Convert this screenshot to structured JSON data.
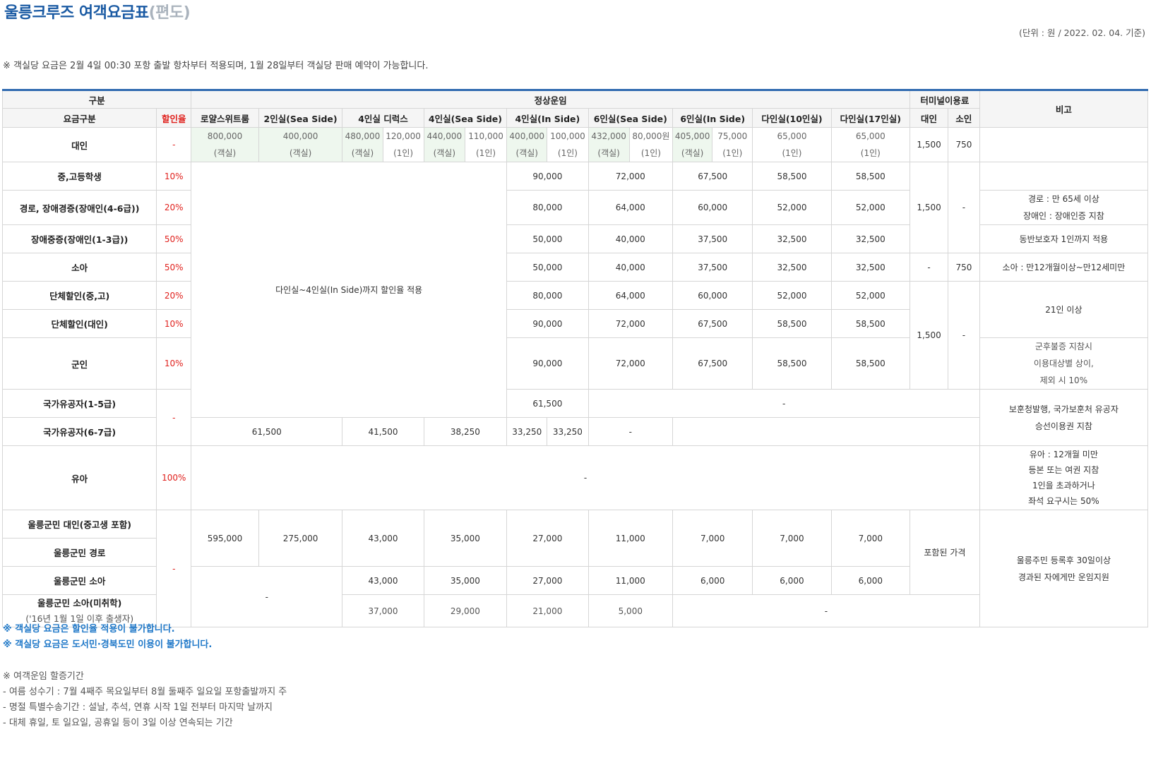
{
  "header": {
    "title": "울릉크루즈 여객요금표",
    "title_suffix": "(편도)",
    "unit_note": "(단위 : 원 / 2022. 02. 04. 기준)",
    "top_note": "※ 객실당 요금은 2월 4일 00:30 포항 출발 항차부터 적용되며, 1월 28일부터 객실당 판매 예약이 가능합니다."
  },
  "table": {
    "h_gubun": "구분",
    "h_normal": "정상운임",
    "h_terminal": "터미널이용료",
    "h_note": "비고",
    "h_fare_type": "요금구분",
    "h_discount": "할인율",
    "h_rooms": [
      "로얄스위트룸",
      "2인실(Sea Side)",
      "4인실 디럭스",
      "4인실(Sea Side)",
      "4인실(In Side)",
      "6인실(Sea Side)",
      "6인실(In Side)",
      "다인실(10인실)",
      "다인실(17인실)"
    ],
    "h_adult": "대인",
    "h_child": "소인",
    "adult": {
      "label": "대인",
      "rate": "-",
      "royal": "800,000",
      "two": "400,000",
      "dlx_room": "480,000",
      "dlx_person": "120,000",
      "sea4_room": "440,000",
      "sea4_person": "110,000",
      "in4_room": "400,000",
      "in4_person": "100,000",
      "sea6_room": "432,000",
      "sea6_person": "80,000원",
      "in6_room": "405,000",
      "in6_person": "75,000",
      "m10": "65,000",
      "m17": "65,000",
      "per_room": "(객실)",
      "per_person": "(1인)",
      "t_adult": "1,500",
      "t_child": "750"
    },
    "discount_note": "다인실~4인실(In Side)까지 할인율 적용",
    "rows": [
      {
        "label": "중,고등학생",
        "rate": "10%",
        "in4": "90,000",
        "sea6": "72,000",
        "in6": "67,500",
        "m10": "58,500",
        "m17": "58,500"
      },
      {
        "label": "경로, 장애경증(장애인(4-6급))",
        "rate": "20%",
        "in4": "80,000",
        "sea6": "64,000",
        "in6": "60,000",
        "m10": "52,000",
        "m17": "52,000"
      },
      {
        "label": "장애중증(장애인(1-3급))",
        "rate": "50%",
        "in4": "50,000",
        "sea6": "40,000",
        "in6": "37,500",
        "m10": "32,500",
        "m17": "32,500"
      },
      {
        "label": "소아",
        "rate": "50%",
        "in4": "50,000",
        "sea6": "40,000",
        "in6": "37,500",
        "m10": "32,500",
        "m17": "32,500"
      },
      {
        "label": "단체할인(중,고)",
        "rate": "20%",
        "in4": "80,000",
        "sea6": "64,000",
        "in6": "60,000",
        "m10": "52,000",
        "m17": "52,000"
      },
      {
        "label": "단체할인(대인)",
        "rate": "10%",
        "in4": "90,000",
        "sea6": "72,000",
        "in6": "67,500",
        "m10": "58,500",
        "m17": "58,500"
      },
      {
        "label": "군인",
        "rate": "10%",
        "in4": "90,000",
        "sea6": "72,000",
        "in6": "67,500",
        "m10": "58,500",
        "m17": "58,500"
      }
    ],
    "term_1500": "1,500",
    "term_dash": "-",
    "term_750": "750",
    "notes": {
      "elderly_1": "경로 : 만 65세 이상",
      "elderly_2": "장애인 : 장애인증 지참",
      "severe": "동반보호자 1인까지 적용",
      "child": "소아 : 만12개월이상~만12세미만",
      "group": "21인 이상",
      "soldier_1": "군후불증 지참시",
      "soldier_2": "이용대상별 상이,",
      "soldier_3": "제외 시 10%",
      "veteran_1": "보훈청발행, 국가보훈처 유공자",
      "veteran_2": "승선이용권 지참",
      "infant_1": "유아 : 12개월 미만",
      "infant_2": "등본 또는 여권 지참",
      "infant_3": "1인을 초과하거나",
      "infant_4": "좌석 요구시는 50%",
      "ulleung_1": "울릉주민 등록후 30일이상",
      "ulleung_2": "경과된 자에게만 운임지원"
    },
    "veteran1": {
      "label": "국가유공자(1-5급)",
      "in4": "61,500",
      "rest": "-"
    },
    "veteran2": {
      "label": "국가유공자(6-7급)",
      "in4": "61,500",
      "sea6": "41,500",
      "in6": "38,250",
      "m10": "33,250",
      "m17": "33,250",
      "term": "-"
    },
    "veteran_rate": "-",
    "infant": {
      "label": "유아",
      "rate": "100%",
      "value": "-"
    },
    "ulleung_rate": "-",
    "ulleung_adult": {
      "label": "울릉군민 대인(중고생 포함)",
      "royal": "595,000",
      "two": "275,000",
      "dlx": "43,000",
      "sea4": "35,000",
      "in4": "27,000",
      "sea6": "11,000",
      "in6": "7,000",
      "m10": "7,000",
      "m17": "7,000",
      "term": "포함된 가격"
    },
    "ulleung_elder": {
      "label": "울릉군민 경로"
    },
    "ulleung_child": {
      "label": "울릉군민 소아",
      "dlx": "43,000",
      "sea4": "35,000",
      "in4": "27,000",
      "sea6": "11,000",
      "in6": "6,000",
      "m10": "6,000",
      "m17": "6,000",
      "left": "-"
    },
    "ulleung_infant": {
      "label": "울릉군민 소아(미취학)",
      "label2": "('16년 1월 1일 이후 출생자)",
      "dlx": "37,000",
      "sea4": "29,000",
      "in4": "21,000",
      "sea6": "5,000",
      "rest": "-"
    }
  },
  "footer": {
    "blue1": "※ 객실당 요금은 할인율 적용이 불가합니다.",
    "blue2": "※ 객실당 요금은 도서민·경북도민 이용이 불가합니다.",
    "p_title": "※ 여객운임 할증기간",
    "p1": "- 여름 성수기 : 7월 4째주 목요일부터 8월 둘째주 일요일 포항출발까지 주",
    "p2": "- 명절 특별수송기간 : 설날, 추석, 연휴 시작 1일 전부터 마지막 날까지",
    "p3": "- 대체 휴일, 토 일요일, 공휴일 등이 3일 이상 연속되는 기간"
  }
}
